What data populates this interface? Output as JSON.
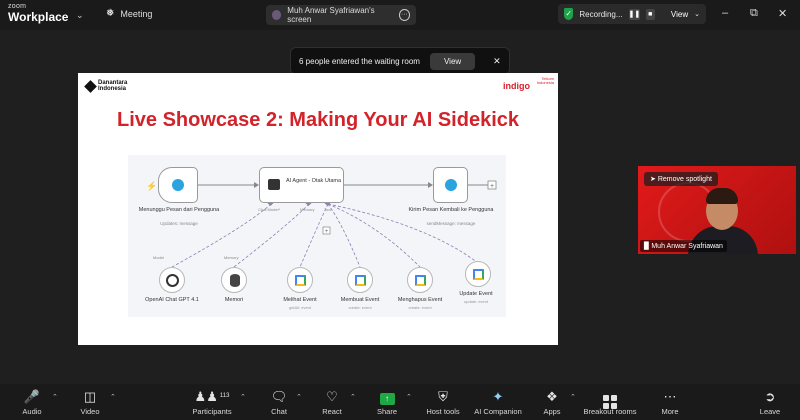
{
  "app": {
    "brand_small": "zoom",
    "brand": "Workplace",
    "meeting_label": "Meeting"
  },
  "screen_share": {
    "label": "Muh Anwar Syafriawan's screen"
  },
  "recording": {
    "label": "Recording...",
    "view": "View"
  },
  "notification": {
    "text": "6 people entered the waiting room",
    "button": "View"
  },
  "slide": {
    "org": "Danantara Indonesia",
    "brand": "indigo",
    "partner": "Telkom Indonesia",
    "title": "Live Showcase 2: Making Your AI Sidekick",
    "nodes": {
      "trigger": {
        "label": "Menunggu Pesan dari Pengguna",
        "sub": "Updates: message"
      },
      "agent": {
        "label": "AI Agent - Otak Utama"
      },
      "reply": {
        "label": "Kirim Pesan Kembali ke Pengguna",
        "sub": "sendMessage: message"
      }
    },
    "handles": {
      "model": "Chat Model*",
      "memory": "Memory",
      "tool": "Tool"
    },
    "branch_labels": {
      "model": "Model",
      "memory": "Memory"
    },
    "tools": [
      {
        "label": "OpenAI Chat GPT 4.1",
        "sub": ""
      },
      {
        "label": "Memori",
        "sub": ""
      },
      {
        "label": "Melihat Event",
        "sub": "getAll: event"
      },
      {
        "label": "Membuat Event",
        "sub": "create: event"
      },
      {
        "label": "Menghapus Event",
        "sub": "create: event"
      },
      {
        "label": "Update Event",
        "sub": "update: event"
      }
    ]
  },
  "video": {
    "spotlight": "Remove spotlight",
    "name": "Muh Anwar Syafriawan"
  },
  "toolbar": {
    "audio": "Audio",
    "video": "Video",
    "participants": "Participants",
    "participants_count": "113",
    "chat": "Chat",
    "react": "React",
    "share": "Share",
    "host_tools": "Host tools",
    "ai_companion": "AI Companion",
    "apps": "Apps",
    "breakout": "Breakout rooms",
    "more": "More",
    "leave": "Leave"
  },
  "colors": {
    "accent_red": "#d2232a",
    "share_green": "#1fa846",
    "telegram": "#2aa3df"
  }
}
